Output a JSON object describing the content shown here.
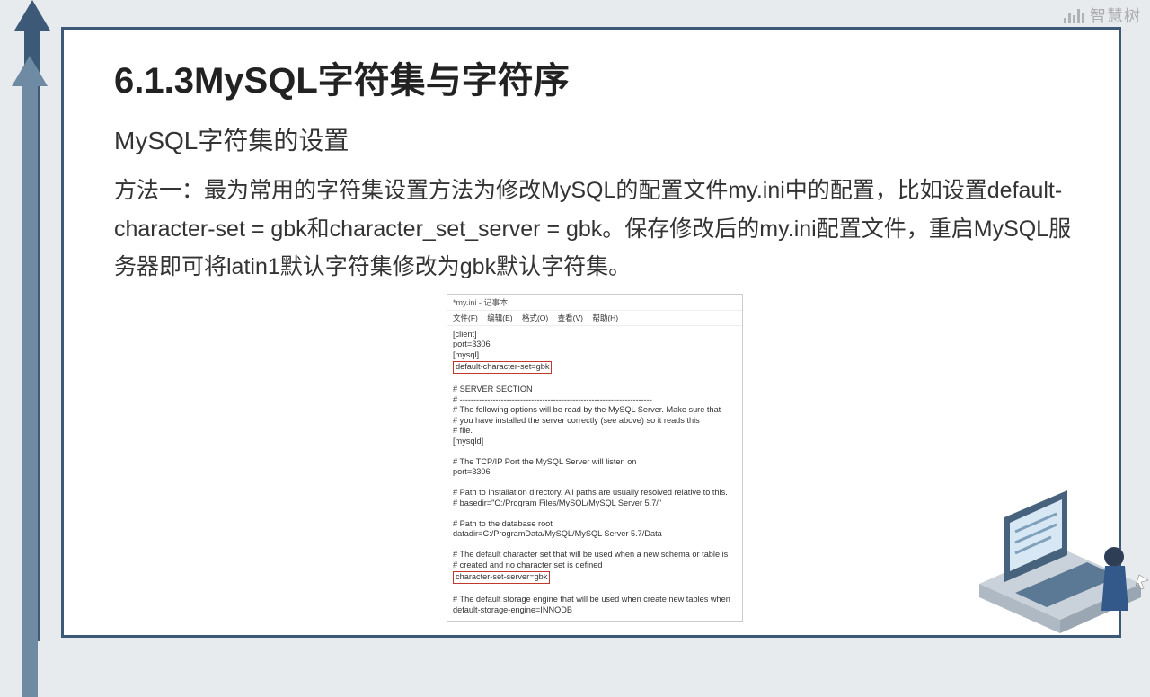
{
  "watermark": "智慧树",
  "title": "6.1.3MySQL字符集与字符序",
  "subtitle": "MySQL字符集的设置",
  "paragraph": "方法一：最为常用的字符集设置方法为修改MySQL的配置文件my.ini中的配置，比如设置default-character-set = gbk和character_set_server = gbk。保存修改后的my.ini配置文件，重启MySQL服务器即可将latin1默认字符集修改为gbk默认字符集。",
  "notepad": {
    "windowTitle": "*my.ini - 记事本",
    "menu": [
      "文件(F)",
      "编辑(E)",
      "格式(O)",
      "查看(V)",
      "帮助(H)"
    ],
    "lines_top": [
      "[client]",
      "port=3306",
      "[mysql]"
    ],
    "highlight1": "default-character-set=gbk",
    "lines_mid": [
      "",
      "# SERVER SECTION",
      "# ----------------------------------------------------------------------",
      "# The following options will be read by the MySQL Server. Make sure that",
      "# you have installed the server correctly (see above) so it reads this",
      "# file.",
      "[mysqld]",
      "",
      "# The TCP/IP Port the MySQL Server will listen on",
      "port=3306",
      "",
      "# Path to installation directory. All paths are usually resolved relative to this.",
      "# basedir=\"C:/Program Files/MySQL/MySQL Server 5.7/\"",
      "",
      "# Path to the database root",
      "datadir=C:/ProgramData/MySQL/MySQL Server 5.7/Data",
      "",
      "# The default character set that will be used when a new schema or table is",
      "# created and no character set is defined"
    ],
    "highlight2": "character-set-server=gbk",
    "lines_bot": [
      "",
      "# The default storage engine that will be used when create new tables when",
      "default-storage-engine=INNODB"
    ]
  }
}
